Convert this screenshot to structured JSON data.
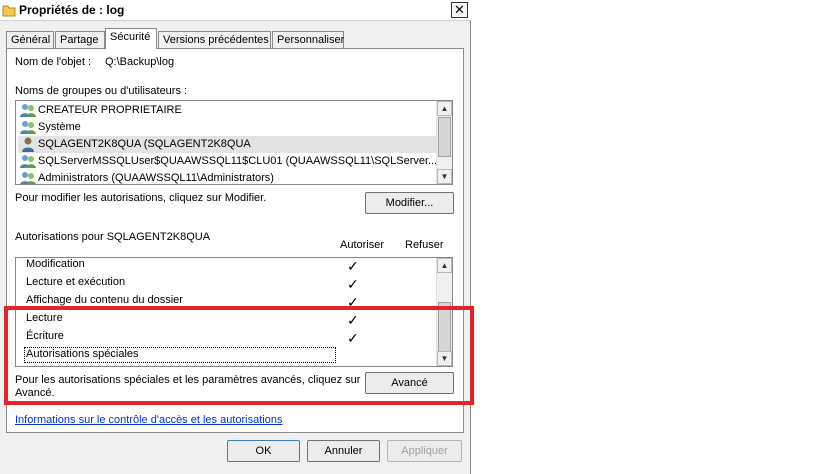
{
  "window": {
    "title": "Propriétés de : log",
    "close_label": "✕"
  },
  "tabs": [
    {
      "label": "Général",
      "active": false
    },
    {
      "label": "Partage",
      "active": false
    },
    {
      "label": "Sécurité",
      "active": true
    },
    {
      "label": "Versions précédentes",
      "active": false
    },
    {
      "label": "Personnaliser",
      "active": false
    }
  ],
  "object": {
    "label": "Nom de l'objet :",
    "value": "Q:\\Backup\\log"
  },
  "groups": {
    "label": "Noms de groupes ou d'utilisateurs :",
    "items": [
      {
        "name": "CREATEUR PROPRIETAIRE",
        "icon": "group-icon",
        "selected": false
      },
      {
        "name": "Système",
        "icon": "group-icon",
        "selected": false
      },
      {
        "name": "SQLAGENT2K8QUA (SQLAGENT2K8QUA",
        "icon": "user-icon",
        "selected": true
      },
      {
        "name": "SQLServerMSSQLUser$QUAAWSSQL11$CLU01 (QUAAWSSQL11\\SQLServer...",
        "icon": "group-icon",
        "selected": false
      },
      {
        "name": "Administrators (QUAAWSSQL11\\Administrators)",
        "icon": "group-icon",
        "selected": false
      }
    ]
  },
  "modify": {
    "hint": "Pour modifier les autorisations, cliquez sur Modifier.",
    "button": "Modifier..."
  },
  "permissions": {
    "label": "Autorisations pour SQLAGENT2K8QUA",
    "allow_header": "Autoriser",
    "deny_header": "Refuser",
    "check_glyph": "✓",
    "items": [
      {
        "name": "Modification",
        "allow": true,
        "deny": false
      },
      {
        "name": "Lecture et exécution",
        "allow": true,
        "deny": false
      },
      {
        "name": "Affichage du contenu du dossier",
        "allow": true,
        "deny": false
      },
      {
        "name": "Lecture",
        "allow": true,
        "deny": false
      },
      {
        "name": "Écriture",
        "allow": true,
        "deny": false
      },
      {
        "name": "Autorisations spéciales",
        "allow": false,
        "deny": false
      }
    ]
  },
  "advanced": {
    "hint_line1": "Pour les autorisations spéciales et les paramètres avancés, cliquez sur",
    "hint_line2": "Avancé.",
    "button": "Avancé"
  },
  "link": "Informations sur le contrôle d'accès et les autorisations",
  "footer": {
    "ok": "OK",
    "cancel": "Annuler",
    "apply": "Appliquer"
  },
  "colors": {
    "highlight": "#e8202a",
    "link": "#0033cc"
  }
}
